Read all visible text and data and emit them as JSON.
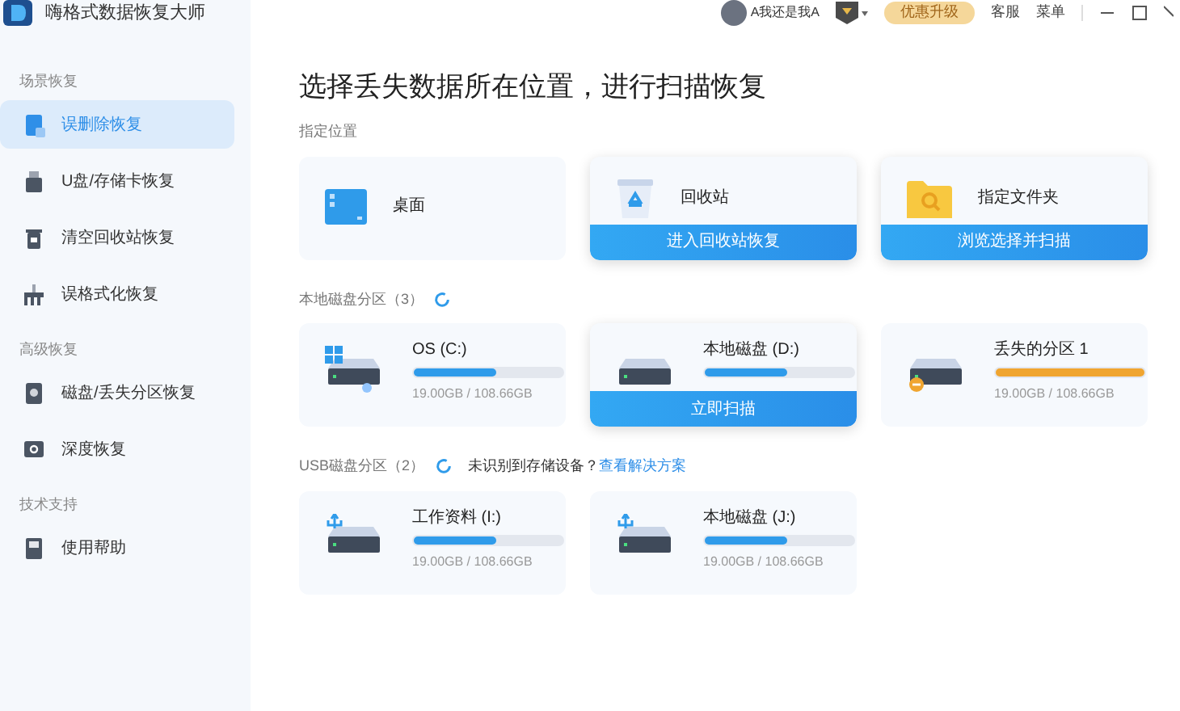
{
  "app": {
    "title": "嗨格式数据恢复大师"
  },
  "topbar": {
    "user": "A我还是我A",
    "upgrade": "优惠升级",
    "links": [
      "客服",
      "菜单"
    ]
  },
  "sidebar": {
    "groups": [
      {
        "label": "场景恢复",
        "items": [
          {
            "label": "误删除恢复",
            "selected": true
          },
          {
            "label": "U盘/存储卡恢复",
            "selected": false
          },
          {
            "label": "清空回收站恢复",
            "selected": false
          },
          {
            "label": "误格式化恢复",
            "selected": false
          }
        ]
      },
      {
        "label": "高级恢复",
        "items": [
          {
            "label": "磁盘/丢失分区恢复",
            "selected": false
          },
          {
            "label": "深度恢复",
            "selected": false
          }
        ]
      },
      {
        "label": "技术支持",
        "items": [
          {
            "label": "使用帮助",
            "selected": false
          }
        ]
      }
    ]
  },
  "heading": "选择丢失数据所在位置，进行扫描恢复",
  "locations": {
    "label": "指定位置",
    "items": [
      {
        "kind": "desktop",
        "name": "桌面",
        "hovered": false
      },
      {
        "kind": "bin",
        "name": "回收站",
        "hovered": true,
        "action": "进入回收站恢复"
      },
      {
        "kind": "folder",
        "name": "指定文件夹",
        "hovered": true,
        "action": "浏览选择并扫描"
      }
    ]
  },
  "local": {
    "label": "本地磁盘分区（3）",
    "items": [
      {
        "kind": "os",
        "name": "OS (C:)",
        "level": 0.55,
        "color": "#2f9bea",
        "reading": "19.00GB / 108.66GB",
        "hovered": false
      },
      {
        "kind": "disk",
        "name": "本地磁盘 (D:)",
        "level": 0.55,
        "color": "#2f9bea",
        "hovered": true,
        "action": "立即扫描"
      },
      {
        "kind": "lost",
        "name": "丢失的分区 1",
        "level": 1,
        "color": "#f0a530",
        "reading": "19.00GB / 108.66GB",
        "hovered": false
      }
    ]
  },
  "usb": {
    "label": "USB磁盘分区（2）",
    "notice": "未识别到存储设备？",
    "link": "查看解决方案",
    "items": [
      {
        "kind": "usb",
        "name": "工作资料 (I:)",
        "level": 0.55,
        "color": "#2f9bea",
        "reading": "19.00GB / 108.66GB",
        "hovered": false
      },
      {
        "kind": "usb",
        "name": "本地磁盘 (J:)",
        "level": 0.55,
        "color": "#2f9bea",
        "reading": "19.00GB / 108.66GB",
        "hovered": false
      }
    ]
  }
}
